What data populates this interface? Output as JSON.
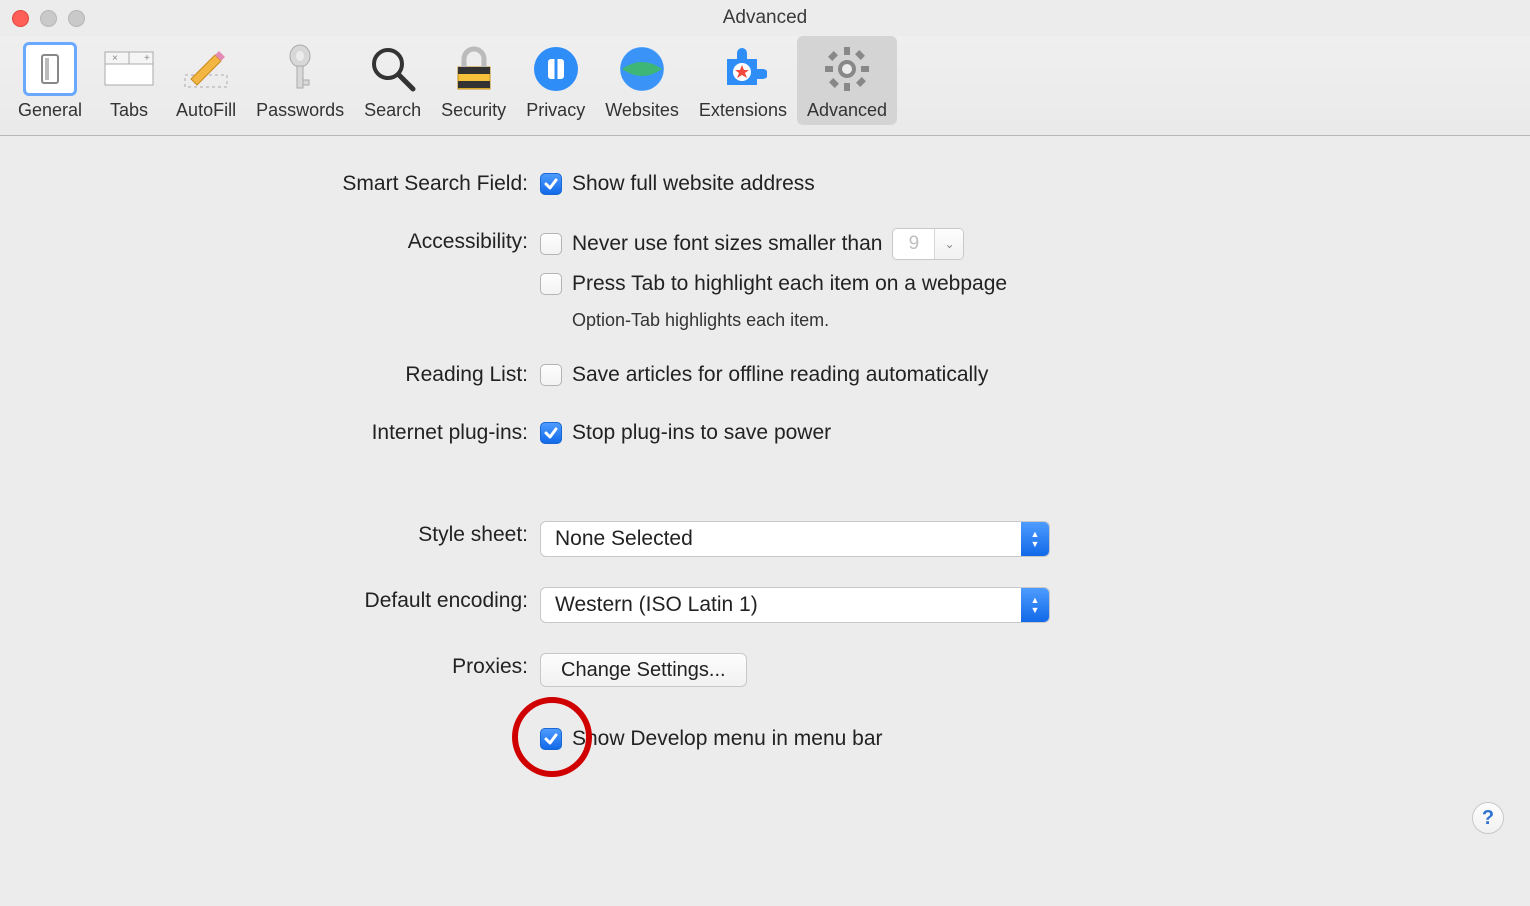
{
  "window": {
    "title": "Advanced"
  },
  "toolbar": {
    "items": [
      {
        "label": "General"
      },
      {
        "label": "Tabs"
      },
      {
        "label": "AutoFill"
      },
      {
        "label": "Passwords"
      },
      {
        "label": "Search"
      },
      {
        "label": "Security"
      },
      {
        "label": "Privacy"
      },
      {
        "label": "Websites"
      },
      {
        "label": "Extensions"
      },
      {
        "label": "Advanced"
      }
    ]
  },
  "sections": {
    "smartSearch": {
      "label": "Smart Search Field:",
      "showFullAddress": "Show full website address"
    },
    "accessibility": {
      "label": "Accessibility:",
      "neverSmaller": "Never use font sizes smaller than",
      "fontSize": "9",
      "pressTab": "Press Tab to highlight each item on a webpage",
      "optionTabHint": "Option-Tab highlights each item."
    },
    "readingList": {
      "label": "Reading List:",
      "saveOffline": "Save articles for offline reading automatically"
    },
    "plugins": {
      "label": "Internet plug-ins:",
      "stopToSave": "Stop plug-ins to save power"
    },
    "styleSheet": {
      "label": "Style sheet:",
      "value": "None Selected"
    },
    "encoding": {
      "label": "Default encoding:",
      "value": "Western (ISO Latin 1)"
    },
    "proxies": {
      "label": "Proxies:",
      "button": "Change Settings..."
    },
    "develop": {
      "label": "Show Develop menu in menu bar"
    }
  },
  "helpGlyph": "?"
}
